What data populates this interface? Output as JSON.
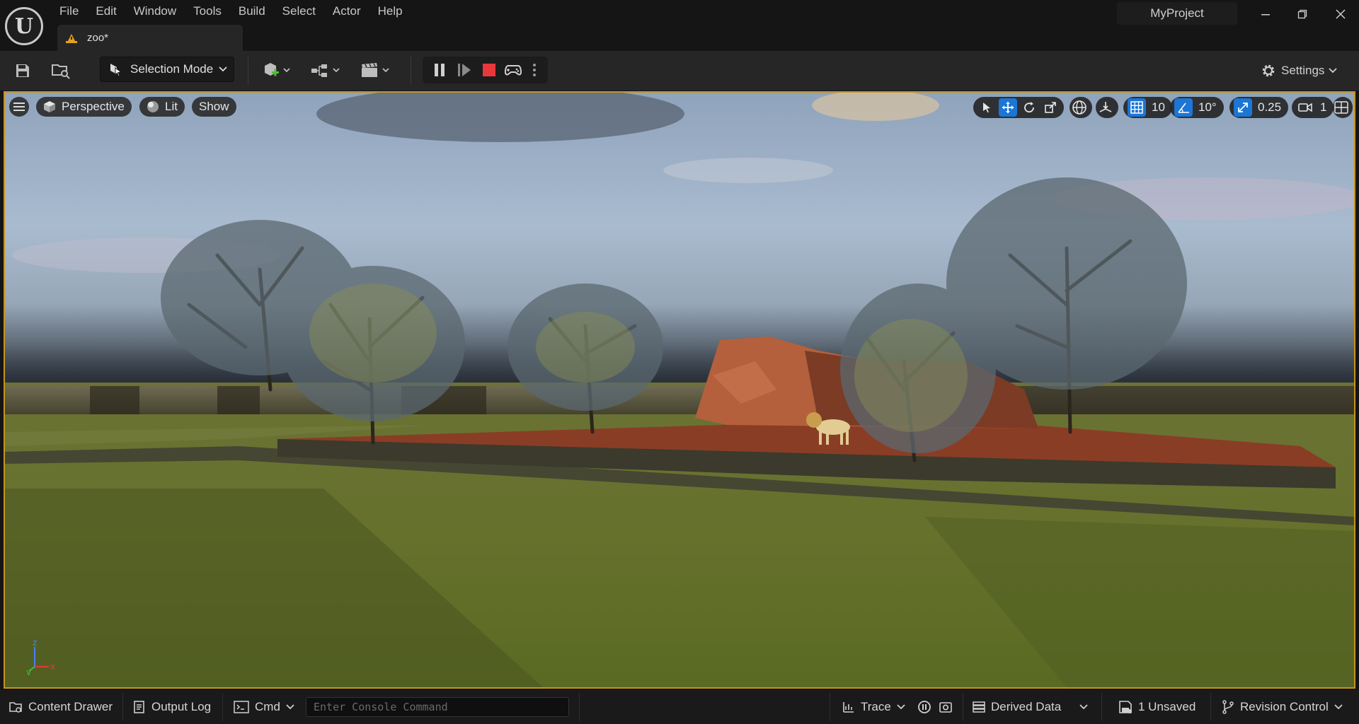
{
  "menu": [
    "File",
    "Edit",
    "Window",
    "Tools",
    "Build",
    "Select",
    "Actor",
    "Help"
  ],
  "document_tab": "zoo*",
  "project_name": "MyProject",
  "toolbar": {
    "selection_mode": "Selection Mode",
    "settings": "Settings"
  },
  "viewport": {
    "view_mode": "Perspective",
    "lighting": "Lit",
    "show": "Show",
    "grid_snap": "10",
    "rotation_snap": "10°",
    "scale_snap": "0.25",
    "camera_speed": "1"
  },
  "statusbar": {
    "content_drawer": "Content Drawer",
    "output_log": "Output Log",
    "cmd": "Cmd",
    "console_placeholder": "Enter Console Command",
    "trace": "Trace",
    "derived_data": "Derived Data",
    "unsaved": "1 Unsaved",
    "revision_control": "Revision Control"
  },
  "colors": {
    "accent_blue": "#1b76d6",
    "viewport_border": "#c7931f",
    "stop_red": "#e8383b",
    "warning_yellow": "#e3a21a"
  }
}
